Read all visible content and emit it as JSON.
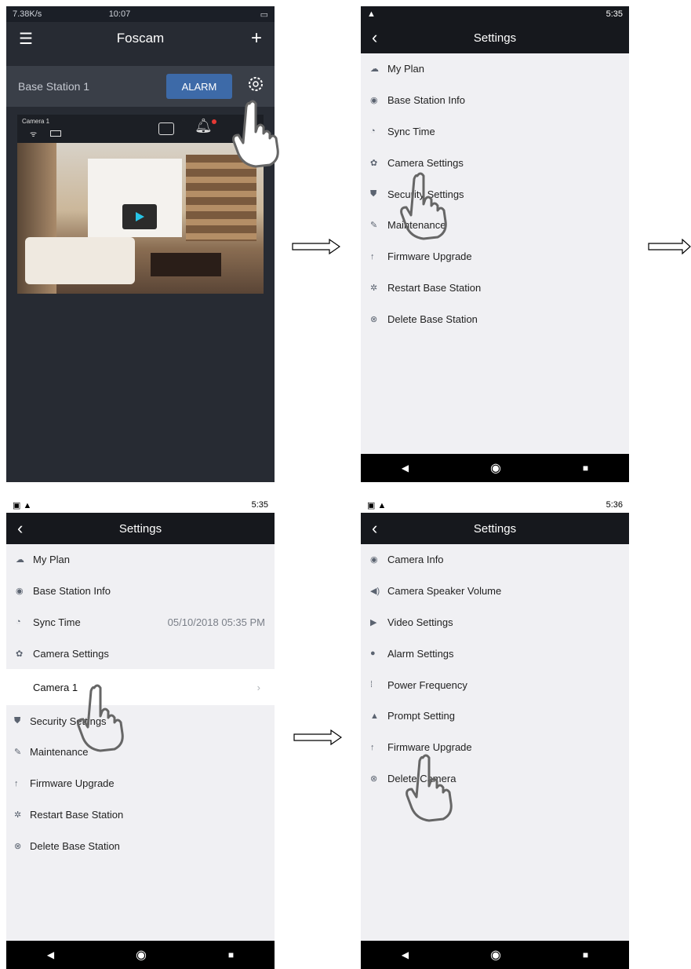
{
  "screen1": {
    "status_left": "7.38K/s",
    "status_time": "10:07",
    "title": "Foscam",
    "station_name": "Base Station 1",
    "alarm_label": "ALARM",
    "camera_name": "Camera 1",
    "icons": [
      "menu-icon",
      "add-icon",
      "gear-icon",
      "wifi-icon",
      "battery-icon",
      "record-icon",
      "bell-icon",
      "play-icon"
    ]
  },
  "screen2": {
    "status_time": "5:35",
    "title": "Settings",
    "items": [
      {
        "label": "My Plan",
        "icon": "cloud-icon"
      },
      {
        "label": "Base Station Info",
        "icon": "station-icon"
      },
      {
        "label": "Sync Time",
        "icon": "clock-icon"
      },
      {
        "label": "Camera Settings",
        "icon": "gear-icon"
      },
      {
        "label": "Security Settings",
        "icon": "shield-icon"
      },
      {
        "label": "Maintenance",
        "icon": "wrench-icon"
      },
      {
        "label": "Firmware Upgrade",
        "icon": "arrow-up-icon"
      },
      {
        "label": "Restart Base Station",
        "icon": "spinner-icon"
      },
      {
        "label": "Delete Base Station",
        "icon": "delete-icon"
      }
    ]
  },
  "screen3": {
    "status_time": "5:35",
    "title": "Settings",
    "items": [
      {
        "label": "My Plan"
      },
      {
        "label": "Base Station Info"
      },
      {
        "label": "Sync Time",
        "value": "05/10/2018 05:35 PM"
      },
      {
        "label": "Camera Settings"
      }
    ],
    "sub_item": "Camera 1",
    "items_after": [
      {
        "label": "Security Settings"
      },
      {
        "label": "Maintenance"
      },
      {
        "label": "Firmware Upgrade"
      },
      {
        "label": "Restart Base Station"
      },
      {
        "label": "Delete Base Station"
      }
    ]
  },
  "screen4": {
    "status_time": "5:36",
    "title": "Settings",
    "items": [
      {
        "label": "Camera Info",
        "icon": "camera-info-icon"
      },
      {
        "label": "Camera Speaker Volume",
        "icon": "speaker-icon"
      },
      {
        "label": "Video Settings",
        "icon": "video-icon"
      },
      {
        "label": "Alarm Settings",
        "icon": "alarm-icon"
      },
      {
        "label": "Power Frequency",
        "icon": "frequency-icon"
      },
      {
        "label": "Prompt Setting",
        "icon": "warning-icon"
      },
      {
        "label": "Firmware Upgrade",
        "icon": "arrow-up-icon"
      },
      {
        "label": "Delete Camera",
        "icon": "delete-icon"
      }
    ]
  }
}
